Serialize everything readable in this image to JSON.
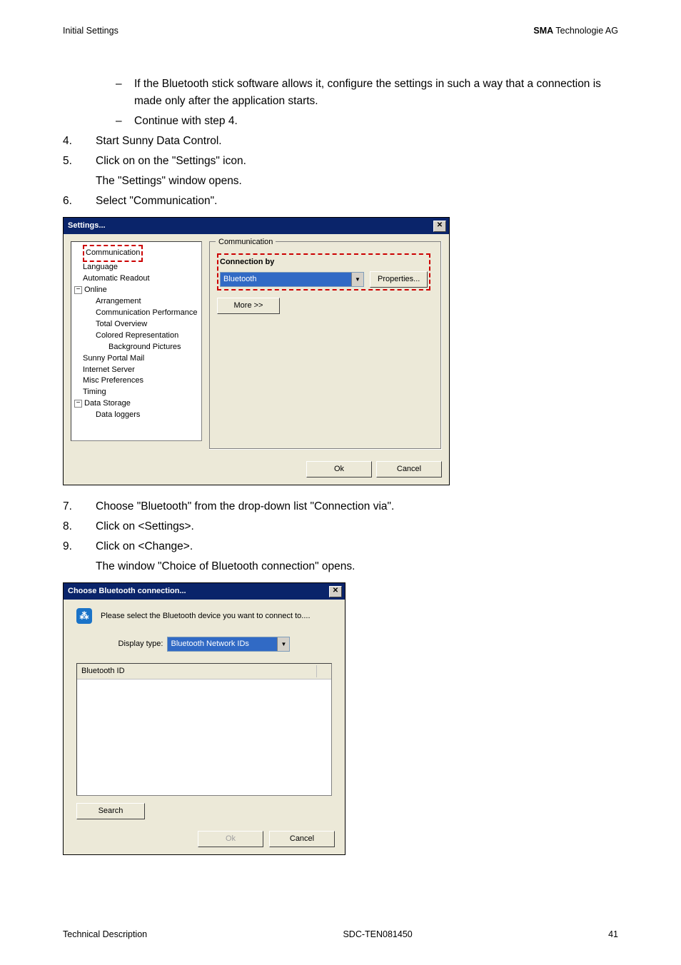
{
  "header": {
    "left": "Initial Settings",
    "right_bold": "SMA",
    "right_rest": " Technologie AG"
  },
  "content": {
    "bullet1": "If the Bluetooth stick software allows it, configure the settings in such a way that a connection is made only after the application starts.",
    "bullet2": "Continue with step 4.",
    "step4": "Start Sunny Data Control.",
    "step5": "Click on on the \"Settings\" icon.",
    "step5b": "The \"Settings\" window opens.",
    "step6": "Select \"Communication\".",
    "step7": "Choose \"Bluetooth\" from the drop-down list \"Connection via\".",
    "step8": "Click on <Settings>.",
    "step9": "Click on <Change>.",
    "step9b": "The window \"Choice of Bluetooth connection\" opens."
  },
  "dlg1": {
    "title": "Settings...",
    "tree": {
      "communication": "Communication",
      "language": "Language",
      "automatic_readout": "Automatic Readout",
      "online": "Online",
      "arrangement": "Arrangement",
      "comm_perf": "Communication Performance",
      "total_overview": "Total Overview",
      "colored_rep": "Colored Representation",
      "background_pics": "Background Pictures",
      "sunny_portal_mail": "Sunny Portal Mail",
      "internet_server": "Internet Server",
      "misc_prefs": "Misc Preferences",
      "timing": "Timing",
      "data_storage": "Data Storage",
      "data_loggers": "Data loggers"
    },
    "group_title": "Communication",
    "connection_by": "Connection by",
    "combo_value": "Bluetooth",
    "properties": "Properties...",
    "more": "More >>",
    "ok": "Ok",
    "cancel": "Cancel"
  },
  "dlg2": {
    "title": "Choose Bluetooth connection...",
    "prompt": "Please select the Bluetooth device you want to connect to....",
    "display_type_label": "Display type:",
    "display_type_value": "Bluetooth Network IDs",
    "col_header": "Bluetooth ID",
    "search": "Search",
    "ok": "Ok",
    "cancel": "Cancel"
  },
  "footer": {
    "left": "Technical Description",
    "mid": "SDC-TEN081450",
    "right": "41"
  }
}
